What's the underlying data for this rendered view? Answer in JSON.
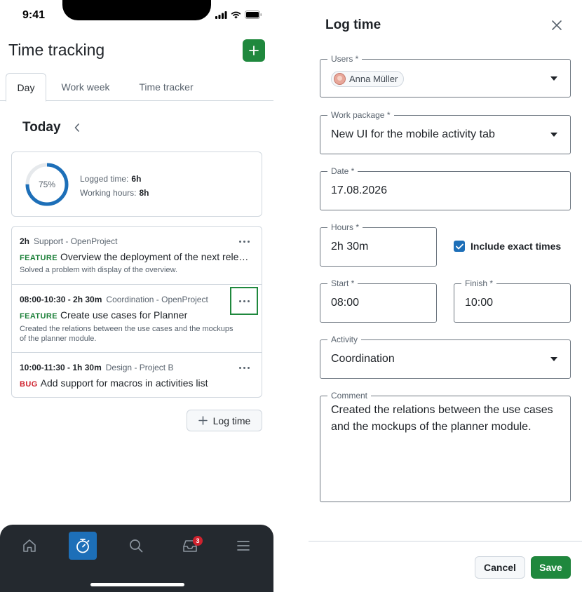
{
  "status_bar": {
    "time": "9:41"
  },
  "header": {
    "title": "Time tracking",
    "add_icon": "plus-icon"
  },
  "tabs": [
    {
      "label": "Day",
      "active": true
    },
    {
      "label": "Work week",
      "active": false
    },
    {
      "label": "Time tracker",
      "active": false
    }
  ],
  "day": {
    "label": "Today",
    "back_icon": "chevron-left-icon"
  },
  "summary": {
    "progress_label": "75%",
    "progress": 0.75,
    "logged_label": "Logged time:",
    "logged_value": "6h",
    "working_label": "Working hours:",
    "working_value": "8h"
  },
  "entries": [
    {
      "duration": "2h",
      "project": "Support - OpenProject",
      "type": "FEATURE",
      "title": "Overview the deployment of the next release",
      "description": "Solved a problem with display of the overview."
    },
    {
      "duration": "08:00-10:30 - 2h 30m",
      "project": "Coordination - OpenProject",
      "type": "FEATURE",
      "title": "Create use cases for Planner",
      "description": "Created the relations between the use cases and the mockups of the planner module."
    },
    {
      "duration": "10:00-11:30 - 1h 30m",
      "project": "Design - Project B",
      "type": "BUG",
      "title": "Add support for macros in activities list",
      "description": ""
    }
  ],
  "log_time_button": {
    "label": "Log time"
  },
  "bottom_nav": {
    "items": [
      "home-icon",
      "stopwatch-icon",
      "search-icon",
      "inbox-icon",
      "menu-icon"
    ],
    "inbox_badge": "3"
  },
  "dialog": {
    "title": "Log time",
    "users": {
      "label": "Users *",
      "value": "Anna Müller"
    },
    "work_package": {
      "label": "Work package *",
      "value": "New UI for the mobile activity tab"
    },
    "date": {
      "label": "Date *",
      "value": "17.08.2026"
    },
    "hours": {
      "label": "Hours *",
      "value": "2h 30m"
    },
    "include_exact_times": {
      "label": "Include exact times",
      "checked": true
    },
    "start": {
      "label": "Start *",
      "value": "08:00"
    },
    "finish": {
      "label": "Finish *",
      "value": "10:00"
    },
    "activity": {
      "label": "Activity",
      "value": "Coordination"
    },
    "comment": {
      "label": "Comment",
      "value": "Created the relations between the use cases and the mockups of the planner module."
    },
    "cancel_label": "Cancel",
    "save_label": "Save"
  },
  "colors": {
    "primary_green": "#1f883d",
    "accent_blue": "#1d6fb8",
    "bug_red": "#cf222e",
    "nav_dark": "#24292f"
  }
}
